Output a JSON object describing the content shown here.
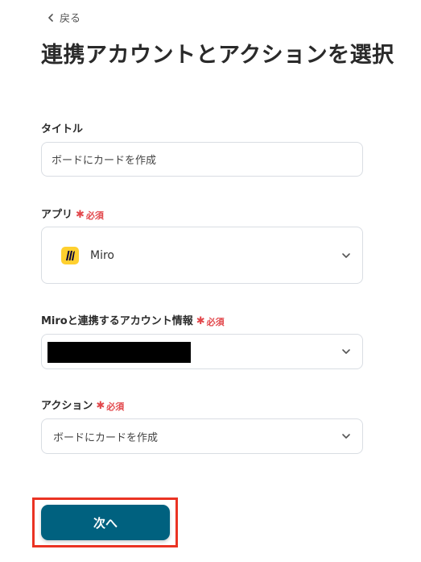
{
  "header": {
    "back_label": "戻る",
    "title": "連携アカウントとアクションを選択"
  },
  "form": {
    "title_field": {
      "label": "タイトル",
      "value": "ボードにカードを作成"
    },
    "app_field": {
      "label": "アプリ",
      "required_mark": "✱",
      "required_text": "必須",
      "selected_app": "Miro",
      "app_icon": "miro-logo-icon"
    },
    "account_field": {
      "label": "Miroと連携するアカウント情報",
      "required_mark": "✱",
      "required_text": "必須"
    },
    "action_field": {
      "label": "アクション",
      "required_mark": "✱",
      "required_text": "必須",
      "selected_value": "ボードにカードを作成"
    }
  },
  "footer": {
    "next_label": "次へ"
  },
  "colors": {
    "primary_button": "#00617f",
    "required": "#e2474b",
    "highlight": "#ea3323",
    "miro_yellow": "#ffd02f"
  }
}
